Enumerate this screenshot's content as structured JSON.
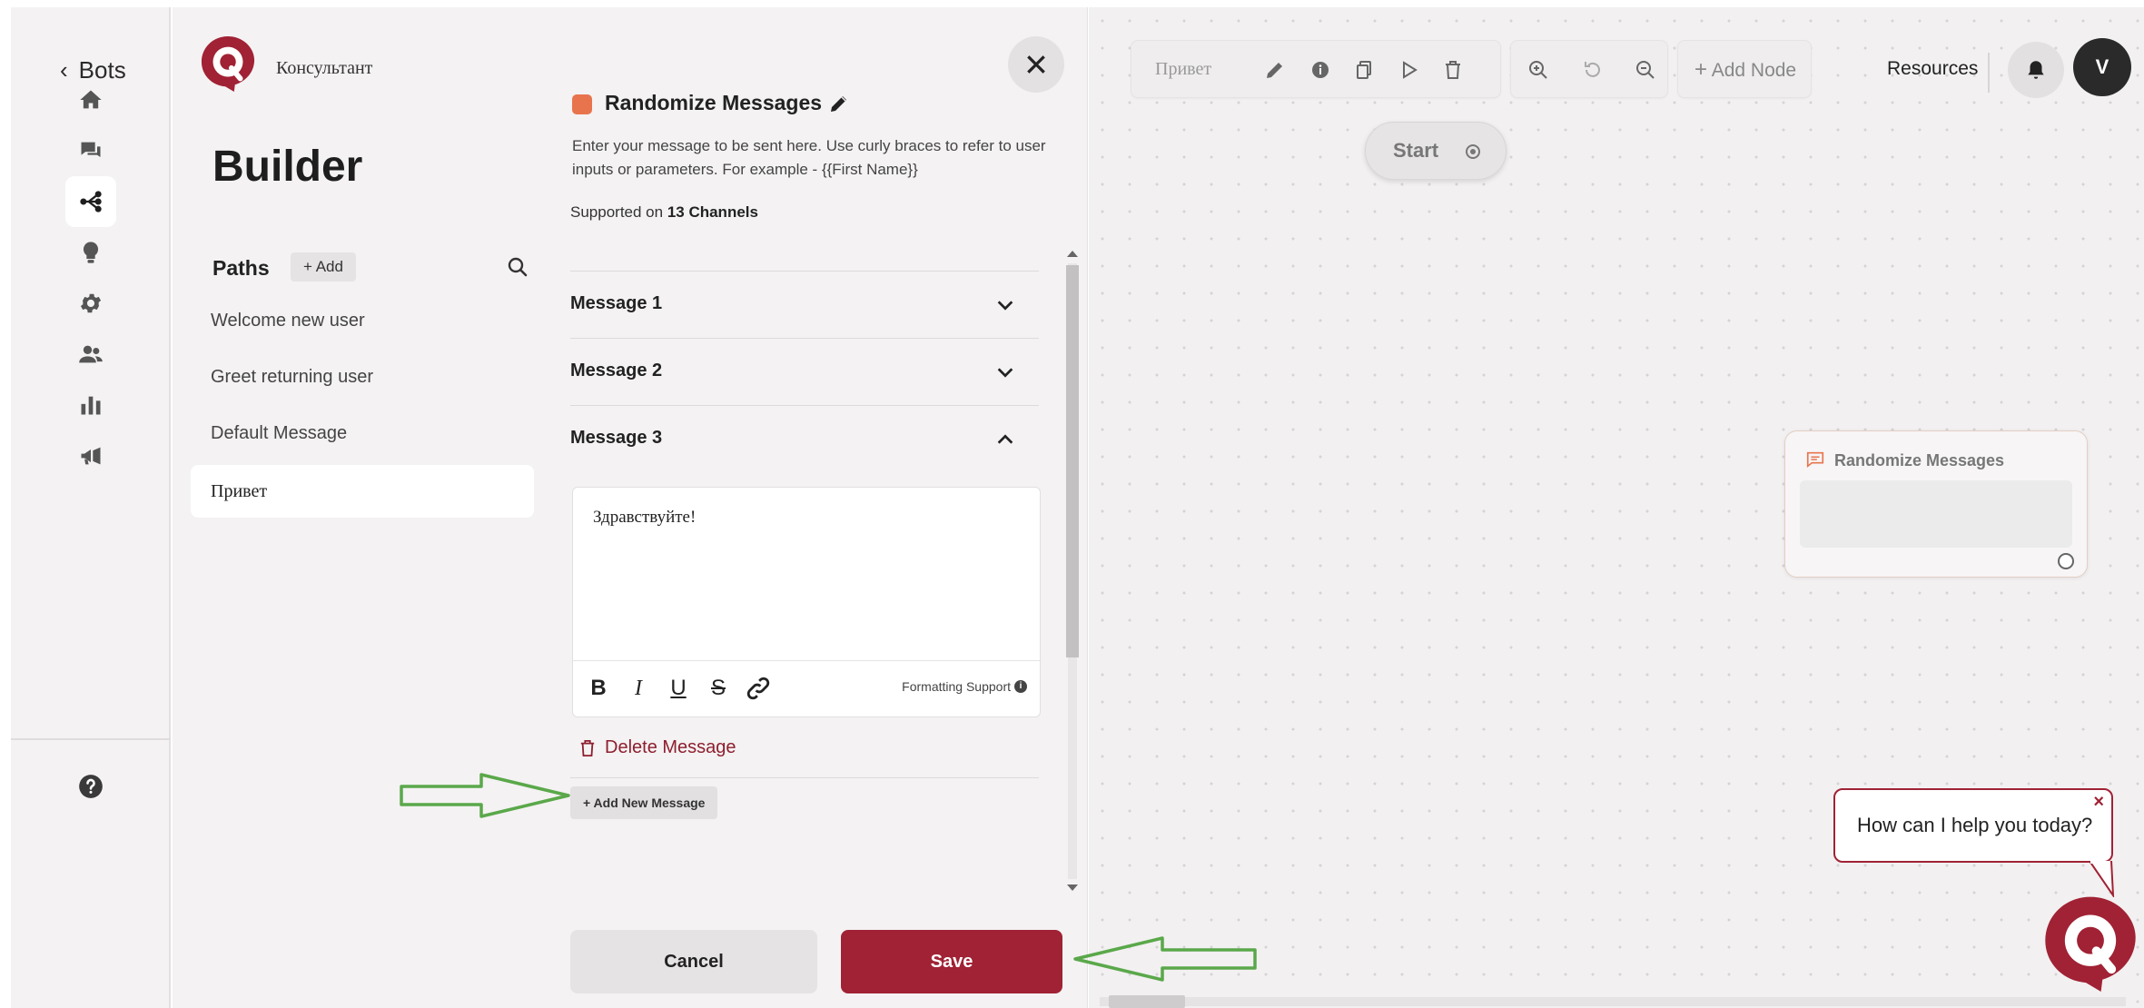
{
  "nav": {
    "back_label": "Bots",
    "items": [
      {
        "icon": "home-icon"
      },
      {
        "icon": "chat-icon"
      },
      {
        "icon": "flow-icon",
        "active": true
      },
      {
        "icon": "lightbulb-icon"
      },
      {
        "icon": "gear-icon"
      },
      {
        "icon": "users-icon"
      },
      {
        "icon": "bar-chart-icon"
      },
      {
        "icon": "megaphone-icon"
      }
    ],
    "help_icon": "question-icon"
  },
  "sidebar": {
    "bot_name": "Консультант",
    "title": "Builder",
    "paths_label": "Paths",
    "add_label": "+ Add",
    "paths": [
      {
        "label": "Welcome new user"
      },
      {
        "label": "Greet returning user"
      },
      {
        "label": "Default Message"
      },
      {
        "label": "Привет",
        "selected": true
      }
    ]
  },
  "editor": {
    "node_title": "Randomize Messages",
    "description": "Enter your message to be sent here. Use curly braces to refer to user inputs or parameters. For example - {{First Name}}",
    "supported_prefix": "Supported on ",
    "supported_channels": "13 Channels",
    "messages": [
      {
        "label": "Message 1",
        "expanded": false
      },
      {
        "label": "Message 2",
        "expanded": false
      },
      {
        "label": "Message 3",
        "expanded": true
      }
    ],
    "message_text": "Здравствуйте!",
    "format_buttons": [
      "B",
      "I",
      "U",
      "S"
    ],
    "formatting_support": "Formatting Support",
    "delete_label": "Delete Message",
    "add_message_label": "+ Add New Message",
    "cancel_label": "Cancel",
    "save_label": "Save"
  },
  "canvas": {
    "path_label": "Привет",
    "add_node_label": "Add Node",
    "resources_label": "Resources",
    "avatar_initial": "V",
    "start_label": "Start",
    "node_label": "Randomize Messages"
  },
  "help": {
    "text": "How can I help you today?",
    "close": "×"
  },
  "colors": {
    "brand": "#a02234",
    "annotation_arrow": "#5aa84a"
  }
}
